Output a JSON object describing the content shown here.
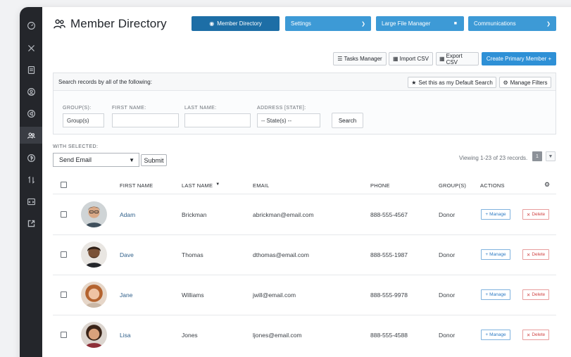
{
  "header": {
    "title": "Member Directory",
    "nav": {
      "member_directory": "Member Directory",
      "settings": "Settings",
      "large_file_manager": "Large File Manager",
      "communications": "Communications"
    }
  },
  "actions": {
    "tasks_manager": "Tasks Manager",
    "import_csv": "Import CSV",
    "export_csv": "Export CSV",
    "create_primary_member": "Create Primary Member +"
  },
  "search": {
    "heading": "Search records by all of the following:",
    "default_search_label": "Set this as my Default Search",
    "manage_filters_label": "Manage Filters",
    "fields": {
      "groups_label": "GROUP(S):",
      "groups_value": "Group(s)",
      "first_name_label": "FIRST NAME:",
      "first_name_value": "",
      "last_name_label": "LAST NAME:",
      "last_name_value": "",
      "state_label": "ADDRESS [STATE]:",
      "state_value": "-- State(s) --"
    },
    "submit_label": "Search"
  },
  "bulk": {
    "label": "WITH SELECTED:",
    "selected_action": "Send Email",
    "submit_label": "Submit"
  },
  "pagination": {
    "summary": "Viewing 1-23 of 23 records.",
    "current_page": "1"
  },
  "table": {
    "columns": {
      "first_name": "FIRST NAME",
      "last_name": "LAST NAME",
      "email": "EMAIL",
      "phone": "PHONE",
      "groups": "GROUP(S)",
      "actions": "ACTIONS"
    },
    "manage_label": "Manage",
    "delete_label": "Delete",
    "rows": [
      {
        "first_name": "Adam",
        "last_name": "Brickman",
        "email": "abrickman@email.com",
        "phone": "888-555-4567",
        "group": "Donor"
      },
      {
        "first_name": "Dave",
        "last_name": "Thomas",
        "email": "dthomas@email.com",
        "phone": "888-555-1987",
        "group": "Donor"
      },
      {
        "first_name": "Jane",
        "last_name": "Williams",
        "email": "jwill@email.com",
        "phone": "888-555-9978",
        "group": "Donor"
      },
      {
        "first_name": "Lisa",
        "last_name": "Jones",
        "email": "ljones@email.com",
        "phone": "888-555-4588",
        "group": "Donor"
      }
    ]
  },
  "colors": {
    "sidebar_bg": "#24262b",
    "primary_dark": "#1d6ea6",
    "primary": "#3d9ad6",
    "link": "#2f5f8a",
    "delete": "#d04545"
  }
}
